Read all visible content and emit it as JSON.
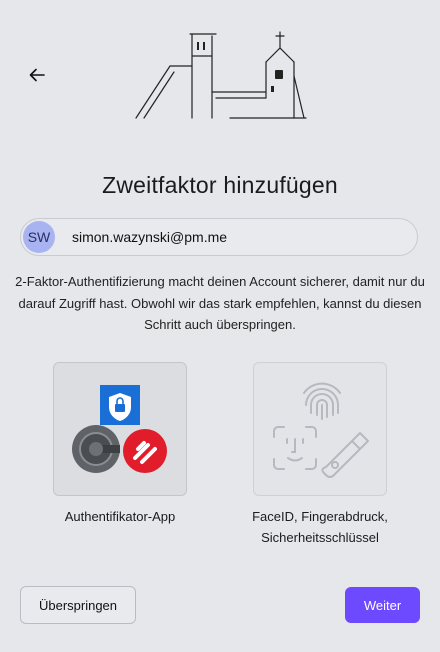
{
  "header": {
    "back_icon": "arrow-left-icon",
    "illustration": "church-sketch"
  },
  "title": "Zweitfaktor hinzufügen",
  "account": {
    "initials": "SW",
    "email": "simon.wazynski@pm.me"
  },
  "description": "2-Faktor-Authentifizierung macht deinen Account sicherer, damit nur du darauf Zugriff hast. Obwohl wir das stark empfehlen, kannst du diesen Schritt auch überspringen.",
  "options": [
    {
      "label": "Authentifikator-App",
      "icons": [
        "microsoft-authenticator-icon",
        "google-authenticator-icon",
        "authy-icon"
      ]
    },
    {
      "label": "FaceID, Fingerabdruck, Sicherheitsschlüssel",
      "icons": [
        "fingerprint-icon",
        "face-id-icon",
        "security-key-icon"
      ]
    }
  ],
  "buttons": {
    "skip": "Überspringen",
    "next": "Weiter"
  },
  "colors": {
    "accent": "#6d4aff",
    "background": "#e6e7ea"
  }
}
